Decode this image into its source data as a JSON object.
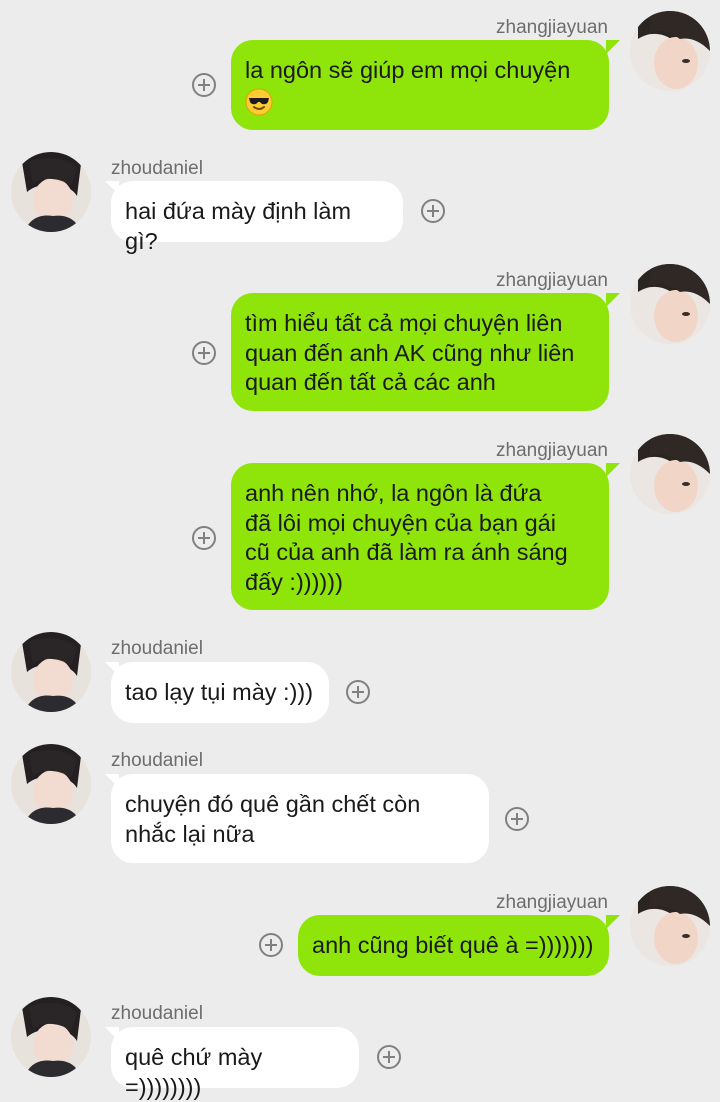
{
  "chat": {
    "messages": [
      {
        "sender": "zhangjiayuan",
        "side": "right",
        "text": "la ngôn sẽ giúp em mọi chuyện",
        "emoji": "smiling-face-with-sunglasses"
      },
      {
        "sender": "zhoudaniel",
        "side": "left",
        "text": "hai đứa mày định làm gì?"
      },
      {
        "sender": "zhangjiayuan",
        "side": "right",
        "text": "tìm hiểu tất cả mọi chuyện liên\nquan đến anh AK cũng như liên\nquan đến tất cả các anh"
      },
      {
        "sender": "zhangjiayuan",
        "side": "right",
        "text": "anh nên nhớ, la ngôn là đứa\nđã lôi mọi chuyện của bạn gái\ncũ của anh đã làm ra ánh sáng\nđấy :))))))"
      },
      {
        "sender": "zhoudaniel",
        "side": "left",
        "text": "tao lạy tụi mày :)))"
      },
      {
        "sender": "zhoudaniel",
        "side": "left",
        "text": "chuyện đó quê gần chết còn\nnhắc lại nữa"
      },
      {
        "sender": "zhangjiayuan",
        "side": "right",
        "text": "anh cũng biết quê à =)))))))"
      },
      {
        "sender": "zhoudaniel",
        "side": "left",
        "text": "quê chứ mày =))))))))"
      }
    ]
  },
  "colors": {
    "background": "#ececec",
    "outgoing_bubble": "#8fe40a",
    "incoming_bubble": "#ffffff",
    "name_text": "#6d6d6d"
  }
}
